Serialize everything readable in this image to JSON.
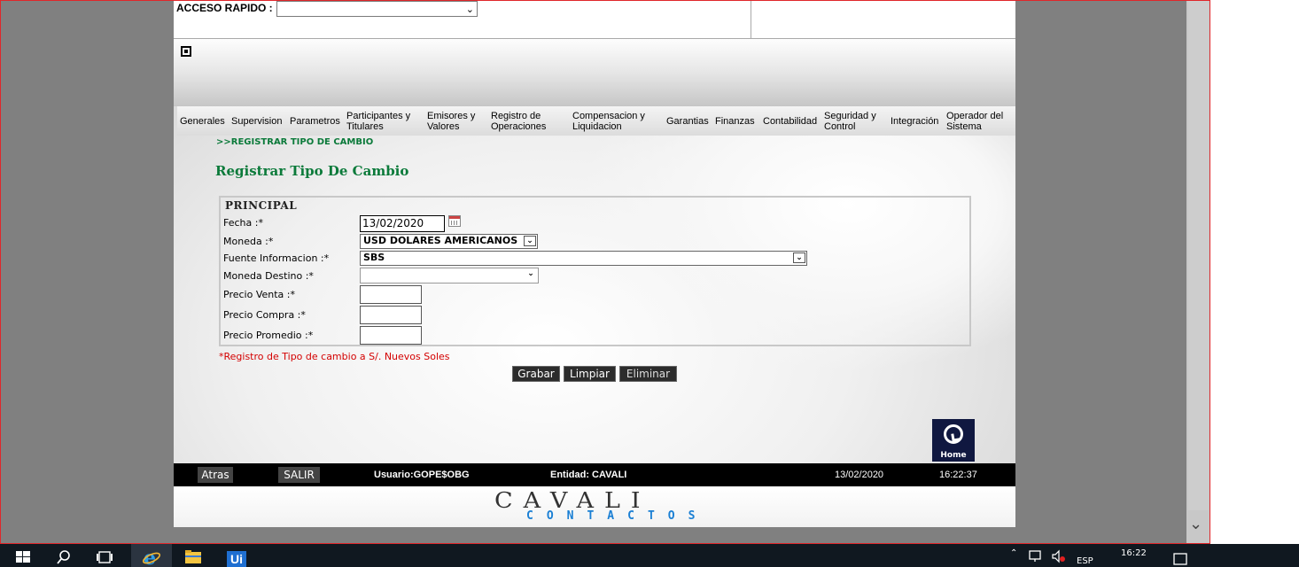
{
  "topbar": {
    "quick_access_label": "ACCESO RAPIDO :",
    "quick_access_value": ""
  },
  "menu": [
    "Generales",
    "Supervision",
    "Parametros",
    "Participantes y Titulares",
    "Emisores y Valores",
    "Registro de Operaciones",
    "Compensacion y Liquidacion",
    "Garantias",
    "Finanzas",
    "Contabilidad",
    "Seguridad y Control",
    "Integración",
    "Operador del Sistema"
  ],
  "breadcrumb": ">>REGISTRAR TIPO DE CAMBIO",
  "page_title": "Registrar Tipo De Cambio",
  "form": {
    "legend": "PRINCIPAL",
    "fecha_label": "Fecha :*",
    "fecha_value": "13/02/2020",
    "moneda_label": "Moneda :*",
    "moneda_value": "USD DOLARES AMERICANOS",
    "fuente_label": "Fuente Informacion :*",
    "fuente_value": "SBS",
    "destino_label": "Moneda Destino :*",
    "destino_value": "",
    "venta_label": "Precio Venta :*",
    "venta_value": "",
    "compra_label": "Precio Compra :*",
    "compra_value": "",
    "promedio_label": "Precio Promedio :*",
    "promedio_value": ""
  },
  "note": "*Registro de Tipo de cambio a S/. Nuevos Soles",
  "buttons": {
    "grabar": "Grabar",
    "limpiar": "Limpiar",
    "eliminar": "Eliminar"
  },
  "home_label": "Home",
  "status": {
    "atras": "Atras",
    "salir": "SALIR",
    "usuario": "Usuario:GOPE$OBG",
    "entidad": "Entidad: CAVALI",
    "fecha": "13/02/2020",
    "hora": "16:22:37"
  },
  "footer": {
    "brand": "CAVALI",
    "sub": "CONTACTOS"
  },
  "taskbar": {
    "lang": "ESP",
    "time": "16:22"
  },
  "colors": {
    "title_green": "#0b7a3a",
    "note_red": "#d40000",
    "footer_blue": "#1a7fd4",
    "status_bar": "#000000"
  }
}
